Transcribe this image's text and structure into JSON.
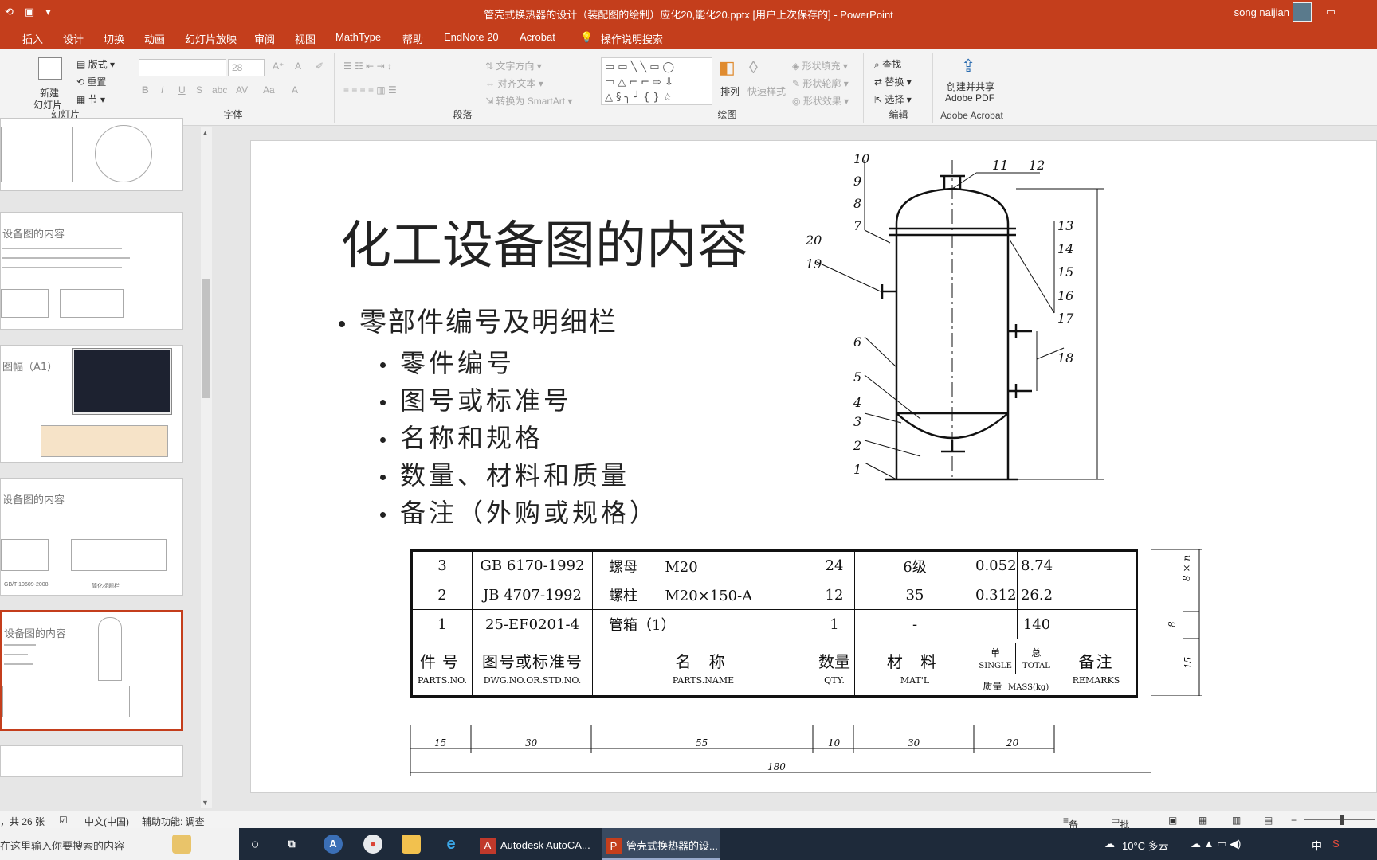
{
  "colors": {
    "accent": "#c43e1c",
    "taskbar": "#1e2a3a"
  },
  "titlebar": {
    "title": "管壳式换热器的设计（装配图的绘制）应化20,能化20.pptx [用户上次保存的]  -  PowerPoint",
    "user": "song naijian"
  },
  "tabs": [
    "插入",
    "设计",
    "切换",
    "动画",
    "幻灯片放映",
    "审阅",
    "视图",
    "MathType",
    "帮助",
    "EndNote 20",
    "Acrobat",
    "操作说明搜索"
  ],
  "ribbon": {
    "slides": {
      "new_slide": "新建",
      "new_slide2": "幻灯片",
      "layout": "版式",
      "reset": "重置",
      "section": "节",
      "label": "幻灯片"
    },
    "font": {
      "size": "28",
      "label": "字体"
    },
    "paragraph": {
      "text_direction": "文字方向",
      "align_text": "对齐文本",
      "smartart": "转换为 SmartArt",
      "label": "段落"
    },
    "drawing": {
      "arrange": "排列",
      "quick_styles": "快速样式",
      "shape_fill": "形状填充",
      "shape_outline": "形状轮廓",
      "shape_effects": "形状效果",
      "label": "绘图"
    },
    "editing": {
      "find": "查找",
      "replace": "替换",
      "select": "选择",
      "label": "编辑"
    },
    "acrobat": {
      "create": "创建并共享",
      "pdf": "Adobe PDF",
      "label": "Adobe Acrobat"
    }
  },
  "thumbnails": [
    {
      "title": ""
    },
    {
      "title": "设备图的内容"
    },
    {
      "title": "图幅（A1）"
    },
    {
      "title": "设备图的内容",
      "caption1": "GB/T 10609-2008",
      "caption2": "简化标题栏"
    },
    {
      "title": "设备图的内容"
    }
  ],
  "slide": {
    "title": "化工设备图的内容",
    "bullet_main": "零部件编号及明细栏",
    "sub_bullets": [
      "零件编号",
      "图号或标准号",
      "名称和规格",
      "数量、材料和质量",
      "备注（外购或规格）"
    ]
  },
  "drawing": {
    "callouts": [
      "1",
      "2",
      "3",
      "4",
      "5",
      "6",
      "7",
      "8",
      "9",
      "10",
      "11",
      "12",
      "13",
      "14",
      "15",
      "16",
      "17",
      "18",
      "19",
      "20"
    ],
    "side_dims": [
      "8 × n",
      "8",
      "15"
    ]
  },
  "parts_table": {
    "rows": [
      {
        "no": "3",
        "std": "GB 6170-1992",
        "name": "螺母",
        "spec": "M20",
        "qty": "24",
        "mat": "6级",
        "single": "0.052",
        "total": "8.74",
        "remark": ""
      },
      {
        "no": "2",
        "std": "JB 4707-1992",
        "name": "螺柱",
        "spec": "M20×150-A",
        "qty": "12",
        "mat": "35",
        "single": "0.312",
        "total": "26.2",
        "remark": ""
      },
      {
        "no": "1",
        "std": "25-EF0201-4",
        "name": "管箱（1）",
        "spec": "",
        "qty": "1",
        "mat": "-",
        "single": "",
        "total": "140",
        "remark": ""
      }
    ],
    "header": {
      "no_cn": "件号",
      "no_en": "PARTS.NO.",
      "std_cn": "图号或标准号",
      "std_en": "DWG.NO.OR.STD.NO.",
      "name_cn": "名 称",
      "name_en": "PARTS.NAME",
      "qty_cn": "数量",
      "qty_en": "QTY.",
      "mat_cn": "材 料",
      "mat_en": "MAT'L",
      "single_cn": "单",
      "single_en": "SINGLE",
      "total_cn": "总",
      "total_en": "TOTAL",
      "mass_cn": "质量",
      "mass_en": "MASS(kg)",
      "remark_cn": "备注",
      "remark_en": "REMARKS"
    },
    "dims": [
      "15",
      "30",
      "55",
      "10",
      "30",
      "20",
      "180"
    ]
  },
  "status": {
    "slide_count": "，共 26 张",
    "language": "中文(中国)",
    "accessibility": "辅助功能: 调查",
    "notes": "备注",
    "comments": "批注"
  },
  "taskbar": {
    "search_placeholder": "在这里输入你要搜索的内容",
    "app1": "Autodesk AutoCA...",
    "app2": "管壳式换热器的设...",
    "weather": "10°C 多云",
    "ime": "中"
  }
}
